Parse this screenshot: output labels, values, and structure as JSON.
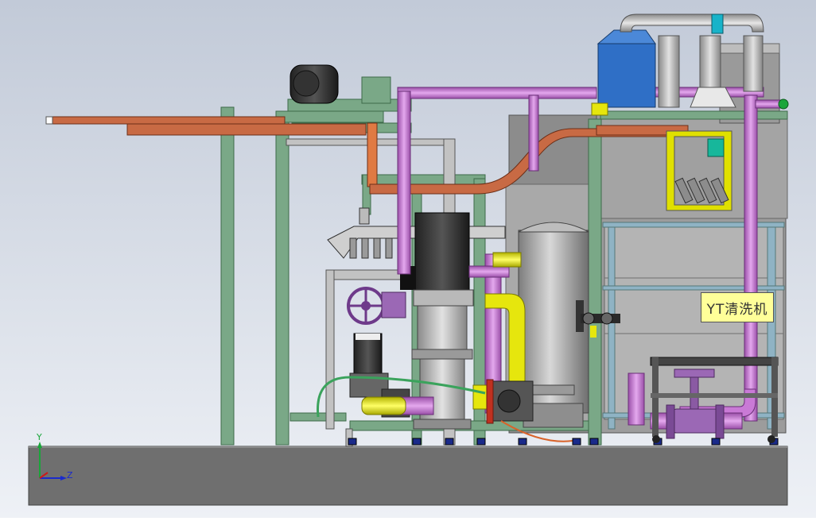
{
  "machine": {
    "nameplate_text": "YT清洗机"
  },
  "triad": {
    "y_label": "Y",
    "z_label": "Z"
  },
  "colors": {
    "background_top": "#c7cfdc",
    "background_bottom": "#e9edf4",
    "base_slab": "#707070",
    "frame_green": "#7aa887",
    "purple_pipe": "#c97ad6",
    "orange_duct": "#c86a44",
    "yellow_pipe": "#e6e60d",
    "blue_hood": "#2f6fc6",
    "steel_gray": "#a8a8a8",
    "nameplate": "#ffff99"
  }
}
